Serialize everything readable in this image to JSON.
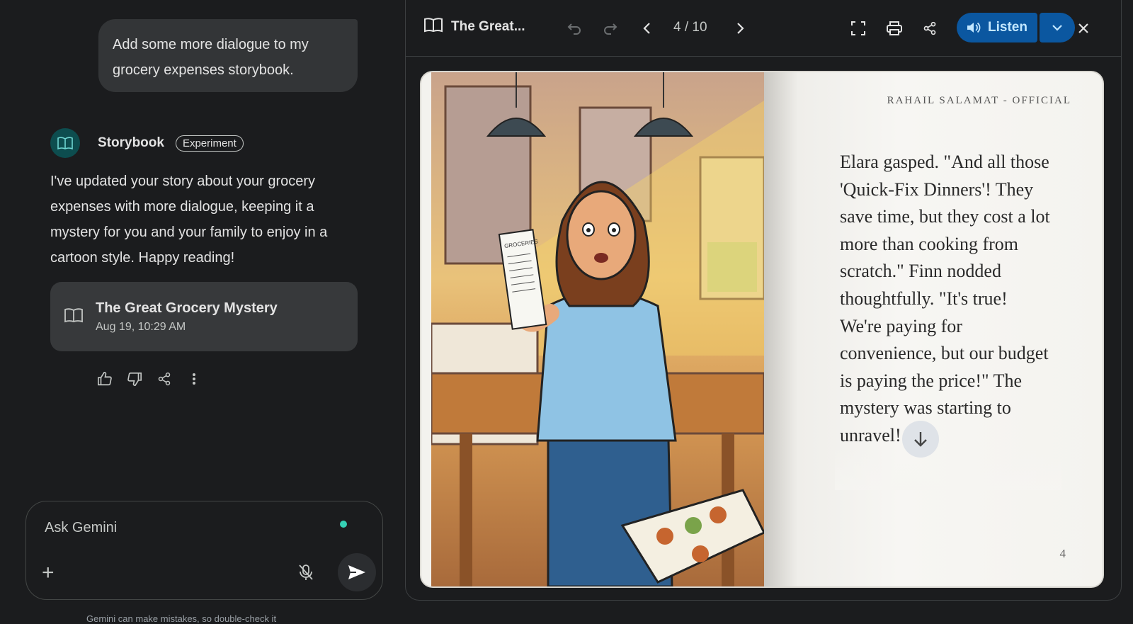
{
  "chat": {
    "user_message": "Add some more dialogue to my grocery expenses storybook.",
    "bot_name": "Storybook",
    "bot_badge": "Experiment",
    "bot_reply": "I've updated your story about your grocery expenses with more dialogue, keeping it a mystery for you and your family to enjoy in a cartoon style. Happy reading!",
    "card": {
      "title": "The Great Grocery Mystery",
      "date": "Aug 19, 10:29 AM"
    },
    "input_placeholder": "Ask Gemini",
    "disclaimer": "Gemini can make mistakes, so double-check it"
  },
  "canvas": {
    "title": "The Great...",
    "page_indicator": "4 / 10",
    "listen_label": "Listen",
    "book": {
      "author": "RAHAIL SALAMAT - OFFICIAL",
      "text": "Elara gasped. \"And all those 'Quick-Fix Dinners'! They save time, but they cost a lot more than cooking from scratch.\" Finn nodded thoughtfully. \"It's true! We're paying for convenience, but our budget is paying the price!\" The mystery was starting to unravel!",
      "page_number": "4",
      "receipt_label": "GROCERIES"
    }
  },
  "colors": {
    "background": "#1b1c1e",
    "bubble": "#333537",
    "accent_blue": "#0b57a0",
    "avatar_teal": "#0d4d4f"
  }
}
